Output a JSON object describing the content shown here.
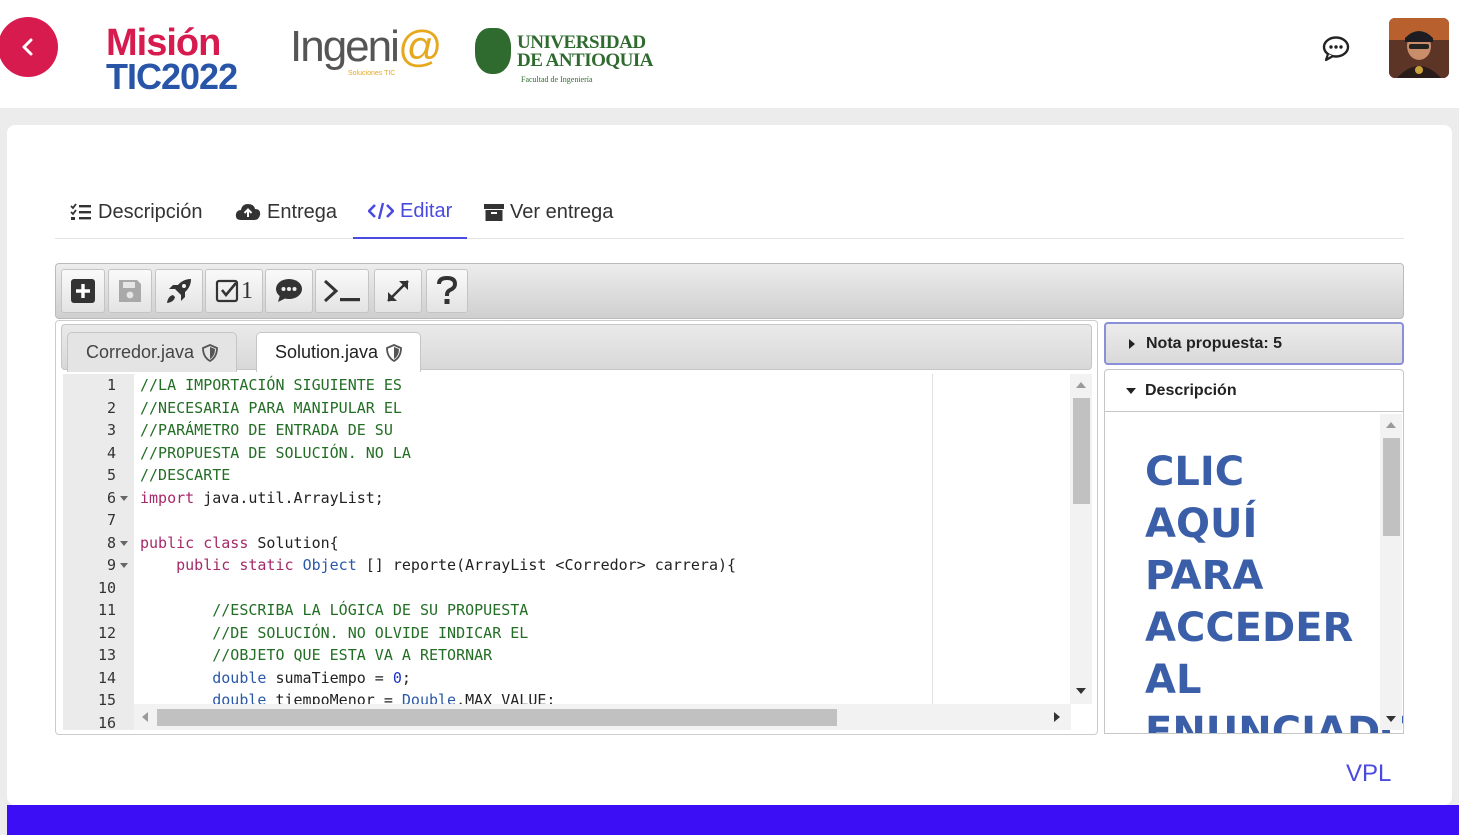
{
  "header": {
    "logo_mision_line1": "Misión",
    "logo_mision_line2a": "TIC",
    "logo_mision_line2b": "2022",
    "logo_ingenia": "Ingeni",
    "logo_ingenia_at": "@",
    "logo_ingenia_sub": "Soluciones TIC",
    "logo_udea_line1": "UNIVERSIDAD",
    "logo_udea_line2": "DE ANTIOQUIA",
    "logo_udea_line3": "Facultad de Ingeniería"
  },
  "tabs": [
    {
      "label": "Descripción",
      "icon": "list-check-icon"
    },
    {
      "label": "Entrega",
      "icon": "cloud-upload-icon"
    },
    {
      "label": "Editar",
      "icon": "code-icon",
      "active": true
    },
    {
      "label": "Ver entrega",
      "icon": "archive-icon"
    }
  ],
  "toolbar": {
    "buttons": [
      "new-file-icon",
      "save-icon",
      "run-icon",
      "evaluate-icon",
      "comments-icon",
      "console-icon",
      "fullscreen-icon",
      "help-icon"
    ],
    "evaluate_count": "1"
  },
  "file_tabs": [
    {
      "name": "Corredor.java",
      "active": false
    },
    {
      "name": "Solution.java",
      "active": true
    }
  ],
  "code": {
    "line_numbers": [
      "1",
      "2",
      "3",
      "4",
      "5",
      "6",
      "7",
      "8",
      "9",
      "10",
      "11",
      "12",
      "13",
      "14",
      "15",
      "16"
    ],
    "lines": [
      "//LA IMPORTACIÓN SIGUIENTE ES",
      "//NECESARIA PARA MANIPULAR EL",
      "//PARÁMETRO DE ENTRADA DE SU",
      "//PROPUESTA DE SOLUCIÓN. NO LA",
      "//DESCARTE",
      "import java.util.ArrayList;",
      "",
      "public class Solution{",
      "    public static Object [] reporte(ArrayList <Corredor> carrera){",
      "",
      "        //ESCRIBA LA LÓGICA DE SU PROPUESTA",
      "        //DE SOLUCIÓN. NO OLVIDE INDICAR EL",
      "        //OBJETO QUE ESTA VA A RETORNAR",
      "        double sumaTiempo = 0;",
      "        double tiempoMenor = Double.MAX_VALUE;",
      ""
    ]
  },
  "side": {
    "nota_label": "Nota propuesta: 5",
    "descripcion_label": "Descripción",
    "link_text": "CLIC AQUÍ PARA ACCEDER AL ENUNCIADO"
  },
  "footer": {
    "vpl_link": "VPL"
  },
  "colors": {
    "accent": "#4a4adf",
    "back_button": "#d81b4f",
    "footer_bar": "#3c0ef5",
    "link_blue": "#3a5ea8"
  }
}
